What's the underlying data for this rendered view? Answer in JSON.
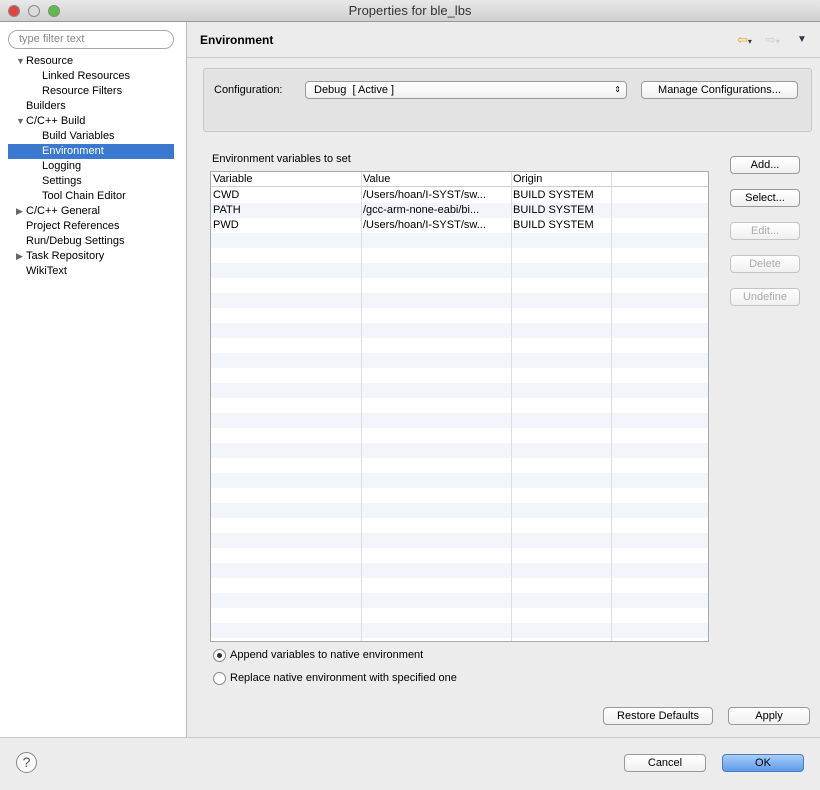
{
  "window": {
    "title": "Properties for ble_lbs"
  },
  "sidebar": {
    "filter_placeholder": "type filter text",
    "items": [
      {
        "label": "Resource",
        "indent": 1,
        "twisty": "expanded"
      },
      {
        "label": "Linked Resources",
        "indent": 2
      },
      {
        "label": "Resource Filters",
        "indent": 2
      },
      {
        "label": "Builders",
        "indent": 1
      },
      {
        "label": "C/C++ Build",
        "indent": 1,
        "twisty": "expanded"
      },
      {
        "label": "Build Variables",
        "indent": 2
      },
      {
        "label": "Environment",
        "indent": 2,
        "selected": true
      },
      {
        "label": "Logging",
        "indent": 2
      },
      {
        "label": "Settings",
        "indent": 2
      },
      {
        "label": "Tool Chain Editor",
        "indent": 2
      },
      {
        "label": "C/C++ General",
        "indent": 1,
        "twisty": "collapsed"
      },
      {
        "label": "Project References",
        "indent": 1
      },
      {
        "label": "Run/Debug Settings",
        "indent": 1
      },
      {
        "label": "Task Repository",
        "indent": 1,
        "twisty": "collapsed"
      },
      {
        "label": "WikiText",
        "indent": 1
      }
    ]
  },
  "header": {
    "title": "Environment"
  },
  "config": {
    "label": "Configuration:",
    "value": "Debug  [ Active ]",
    "manage_label": "Manage Configurations..."
  },
  "env": {
    "section_label": "Environment variables to set",
    "columns": [
      "Variable",
      "Value",
      "Origin"
    ],
    "rows": [
      [
        "CWD",
        "/Users/hoan/I-SYST/sw...",
        "BUILD SYSTEM"
      ],
      [
        "PATH",
        "/gcc-arm-none-eabi/bi...",
        "BUILD SYSTEM"
      ],
      [
        "PWD",
        "/Users/hoan/I-SYST/sw...",
        "BUILD SYSTEM"
      ]
    ]
  },
  "buttons": {
    "add": "Add...",
    "select": "Select...",
    "edit": "Edit...",
    "delete": "Delete",
    "undefine": "Undefine",
    "restore": "Restore Defaults",
    "apply": "Apply",
    "cancel": "Cancel",
    "ok": "OK"
  },
  "options": {
    "append": "Append variables to native environment",
    "replace": "Replace native environment with specified one",
    "selected": "append"
  },
  "colors": {
    "selection": "#3b78d0",
    "ok_button": "#6fa8ef"
  }
}
